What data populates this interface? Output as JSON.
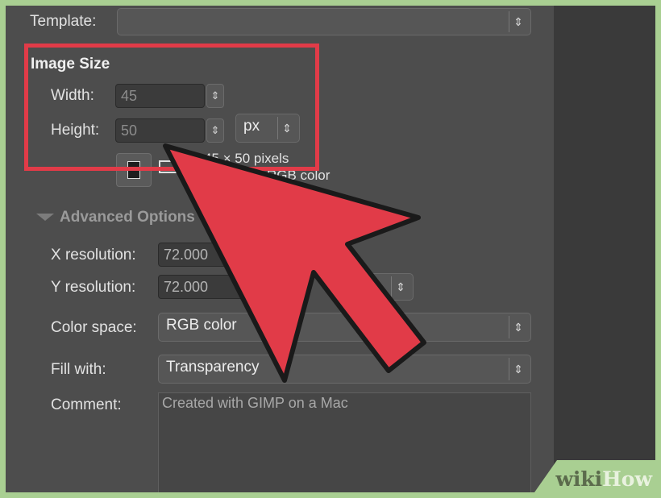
{
  "template": {
    "label": "Template:",
    "value": ""
  },
  "image_size": {
    "heading": "Image Size",
    "width_label": "Width:",
    "width_value": "45",
    "height_label": "Height:",
    "height_value": "50",
    "unit": "px",
    "size_info": "45 × 50 pixels",
    "color_info": "RGB color"
  },
  "advanced": {
    "label": "Advanced Options",
    "x_res_label": "X resolution:",
    "x_res_value": "72.000",
    "y_res_label": "Y resolution:",
    "y_res_value": "72.000",
    "color_space_label": "Color space:",
    "color_space_value": "RGB color",
    "fill_label": "Fill with:",
    "fill_value": "Transparency",
    "comment_label": "Comment:",
    "comment_value": "Created with GIMP on a Mac"
  },
  "icons": {
    "spin": "up-down-arrows-icon",
    "portrait": "portrait-orientation-icon",
    "landscape": "landscape-orientation-icon",
    "expander": "triangle-expander-icon"
  },
  "colors": {
    "highlight": "#e13b48",
    "arrow": "#e13b48",
    "watermark_bg": "#a9cf92"
  },
  "watermark": {
    "wiki": "wiki",
    "how": "How"
  }
}
